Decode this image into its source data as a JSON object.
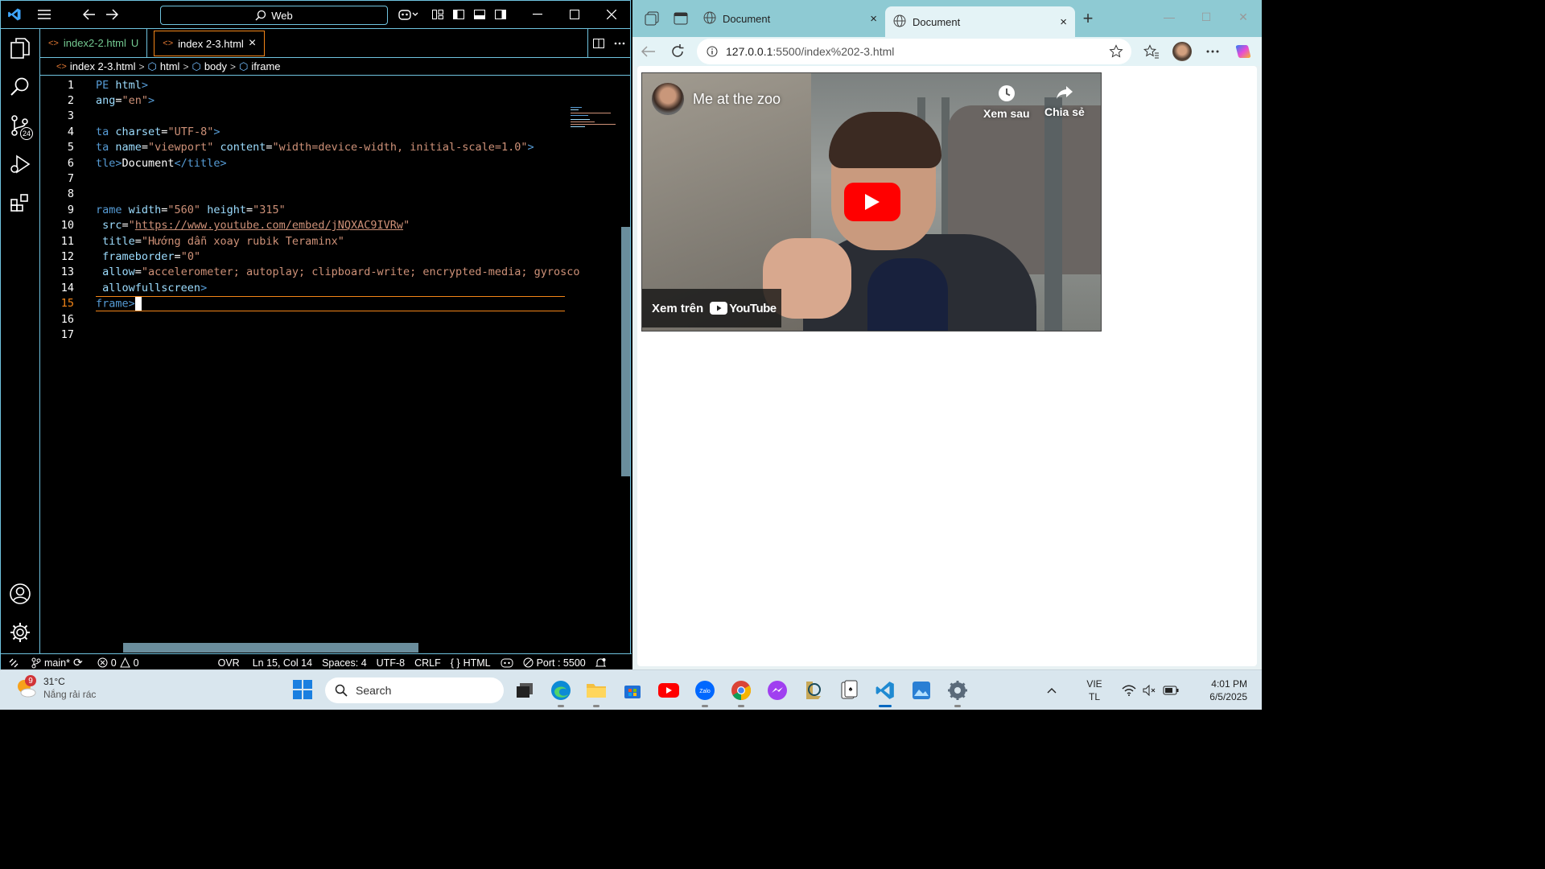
{
  "vscode": {
    "search_label": "Web",
    "tabs": [
      {
        "label": "index2-2.html",
        "status": "U"
      },
      {
        "label": "index 2-3.html",
        "close": "×"
      }
    ],
    "breadcrumb": [
      "index 2-3.html",
      "html",
      "body",
      "iframe"
    ],
    "scm_badge": "24",
    "code_lines": [
      {
        "n": "1",
        "parts": [
          [
            "tg",
            "PE "
          ],
          [
            "at",
            "html"
          ],
          [
            "tg",
            ">"
          ]
        ]
      },
      {
        "n": "2",
        "parts": [
          [
            "at",
            "ang"
          ],
          [
            "wt",
            "="
          ],
          [
            "st",
            "\"en\""
          ],
          [
            "tg",
            ">"
          ]
        ]
      },
      {
        "n": "3",
        "parts": []
      },
      {
        "n": "4",
        "parts": [
          [
            "tg",
            "ta "
          ],
          [
            "at",
            "charset"
          ],
          [
            "wt",
            "="
          ],
          [
            "st",
            "\"UTF-8\""
          ],
          [
            "tg",
            ">"
          ]
        ]
      },
      {
        "n": "5",
        "parts": [
          [
            "tg",
            "ta "
          ],
          [
            "at",
            "name"
          ],
          [
            "wt",
            "="
          ],
          [
            "st",
            "\"viewport\""
          ],
          [
            "wt",
            " "
          ],
          [
            "at",
            "content"
          ],
          [
            "wt",
            "="
          ],
          [
            "st",
            "\"width=device-width, initial-scale=1.0\""
          ],
          [
            "tg",
            ">"
          ]
        ]
      },
      {
        "n": "6",
        "parts": [
          [
            "tg",
            "tle>"
          ],
          [
            "wt",
            "Document"
          ],
          [
            "tg",
            "</title>"
          ]
        ]
      },
      {
        "n": "7",
        "parts": []
      },
      {
        "n": "8",
        "parts": []
      },
      {
        "n": "9",
        "parts": [
          [
            "tg",
            "rame "
          ],
          [
            "at",
            "width"
          ],
          [
            "wt",
            "="
          ],
          [
            "st",
            "\"560\""
          ],
          [
            "wt",
            " "
          ],
          [
            "at",
            "height"
          ],
          [
            "wt",
            "="
          ],
          [
            "st",
            "\"315\""
          ]
        ]
      },
      {
        "n": "10",
        "parts": [
          [
            "wt",
            " "
          ],
          [
            "at",
            "src"
          ],
          [
            "wt",
            "="
          ],
          [
            "st",
            "\""
          ],
          [
            "url",
            "https://www.youtube.com/embed/jNQXAC9IVRw"
          ],
          [
            "st",
            "\""
          ]
        ]
      },
      {
        "n": "11",
        "parts": [
          [
            "wt",
            " "
          ],
          [
            "at",
            "title"
          ],
          [
            "wt",
            "="
          ],
          [
            "st",
            "\"Hướng dẫn xoay rubik Teraminx\""
          ]
        ]
      },
      {
        "n": "12",
        "parts": [
          [
            "wt",
            " "
          ],
          [
            "at",
            "frameborder"
          ],
          [
            "wt",
            "="
          ],
          [
            "st",
            "\"0\""
          ]
        ]
      },
      {
        "n": "13",
        "parts": [
          [
            "wt",
            " "
          ],
          [
            "at",
            "allow"
          ],
          [
            "wt",
            "="
          ],
          [
            "st",
            "\"accelerometer; autoplay; clipboard-write; encrypted-media; gyrosco"
          ]
        ]
      },
      {
        "n": "14",
        "parts": [
          [
            "wt",
            " "
          ],
          [
            "at",
            "allowfullscreen"
          ],
          [
            "tg",
            ">"
          ]
        ]
      },
      {
        "n": "15",
        "parts": [
          [
            "tg",
            "frame>"
          ]
        ],
        "current": true
      },
      {
        "n": "16",
        "parts": []
      },
      {
        "n": "17",
        "parts": []
      }
    ],
    "status": {
      "branch": "main*",
      "errors": "0",
      "warnings": "0",
      "ovr": "OVR",
      "position": "Ln 15, Col 14",
      "spaces": "Spaces: 4",
      "encoding": "UTF-8",
      "eol": "CRLF",
      "language": "HTML",
      "port": "Port : 5500"
    }
  },
  "browser": {
    "tabs": [
      {
        "label": "Document",
        "close": "×"
      },
      {
        "label": "Document",
        "close": "×"
      }
    ],
    "new_tab": "+",
    "url_host": "127.0.0.1",
    "url_rest": ":5500/index%202-3.html",
    "video": {
      "title": "Me at the zoo",
      "watch_later": "Xem sau",
      "share": "Chia sẻ",
      "watch_on": "Xem trên",
      "youtube_logo": "YouTube"
    }
  },
  "taskbar": {
    "weather_badge": "9",
    "temperature": "31°C",
    "weather_desc": "Nắng rải rác",
    "search_placeholder": "Search",
    "lang_top": "VIE",
    "lang_bottom": "TL",
    "time": "4:01 PM",
    "date": "6/5/2025",
    "zalo_label": "Zalo"
  },
  "colors": {
    "vscode_border": "#6fc3df",
    "active_tab_border": "#f38518",
    "browser_tabstrip": "#8ecad3",
    "youtube_red": "#ff0000"
  }
}
